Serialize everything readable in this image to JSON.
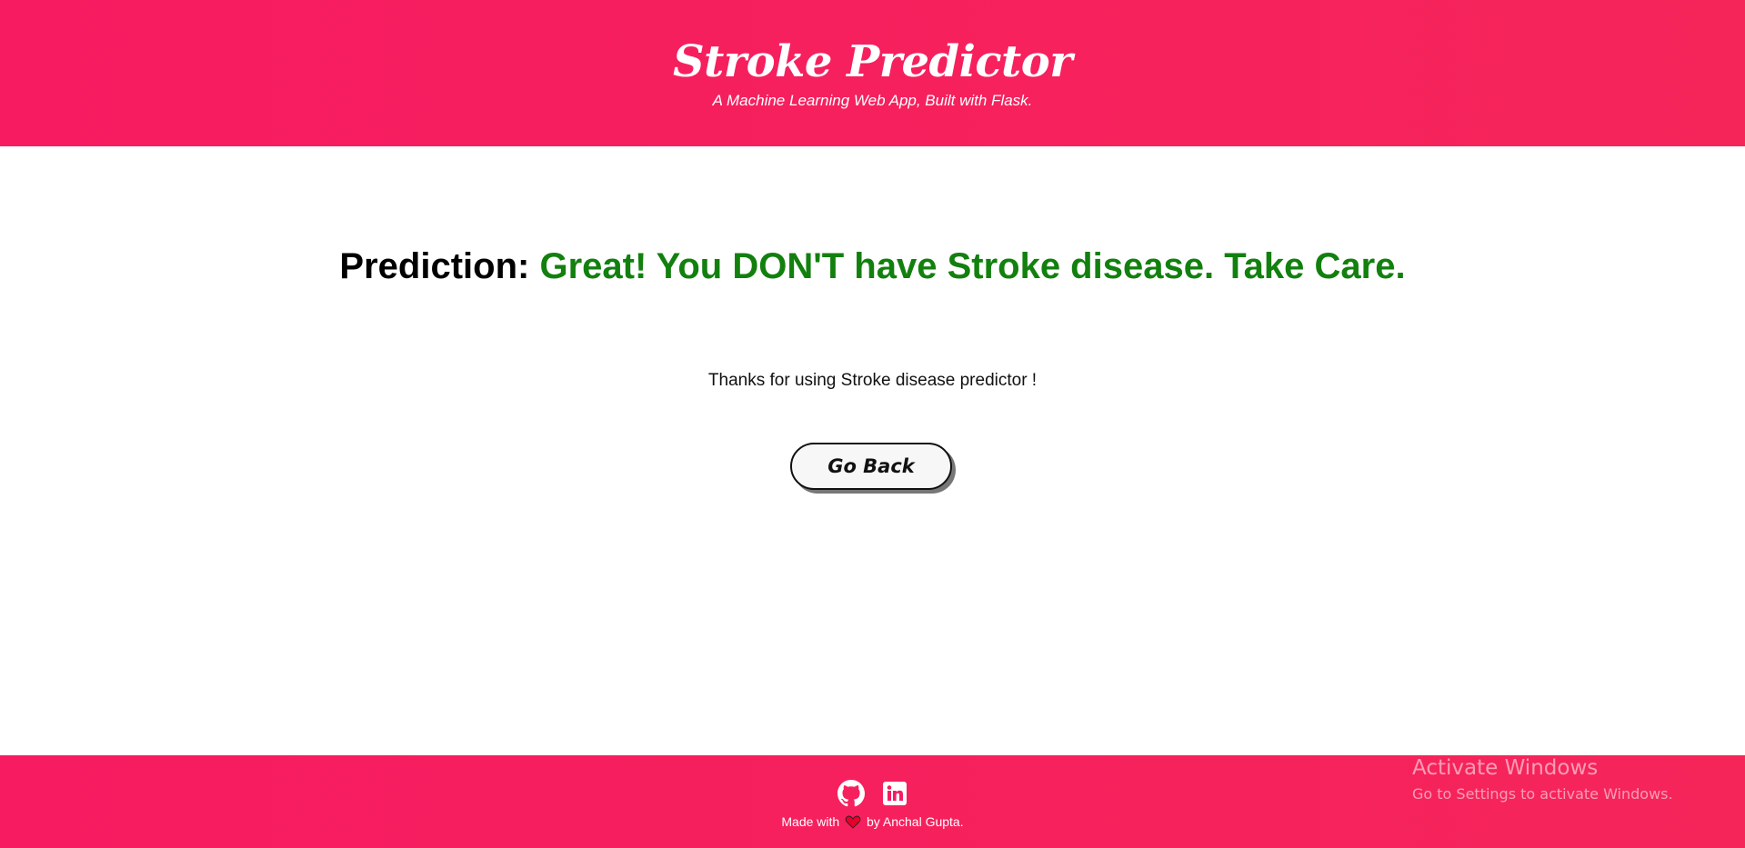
{
  "header": {
    "title": "Stroke Predictor",
    "subtitle": "A Machine Learning Web App, Built with Flask."
  },
  "result": {
    "label": "Prediction:",
    "text": "Great! You DON'T have Stroke disease. Take Care.",
    "text_color": "#12800e"
  },
  "thanks_message": "Thanks for using Stroke disease predictor !",
  "go_back_label": "Go Back",
  "footer": {
    "social_icons": [
      "github-icon",
      "linkedin-icon"
    ],
    "made_with": "Made with",
    "heart_icon": "heart-icon",
    "by_author": "by Anchal Gupta."
  },
  "os_watermark": {
    "title": "Activate Windows",
    "subtitle": "Go to Settings to activate Windows."
  },
  "colors": {
    "brand": "#f71b61",
    "brand_end": "#f5255a",
    "success": "#12800e",
    "heart": "#e8002a"
  }
}
